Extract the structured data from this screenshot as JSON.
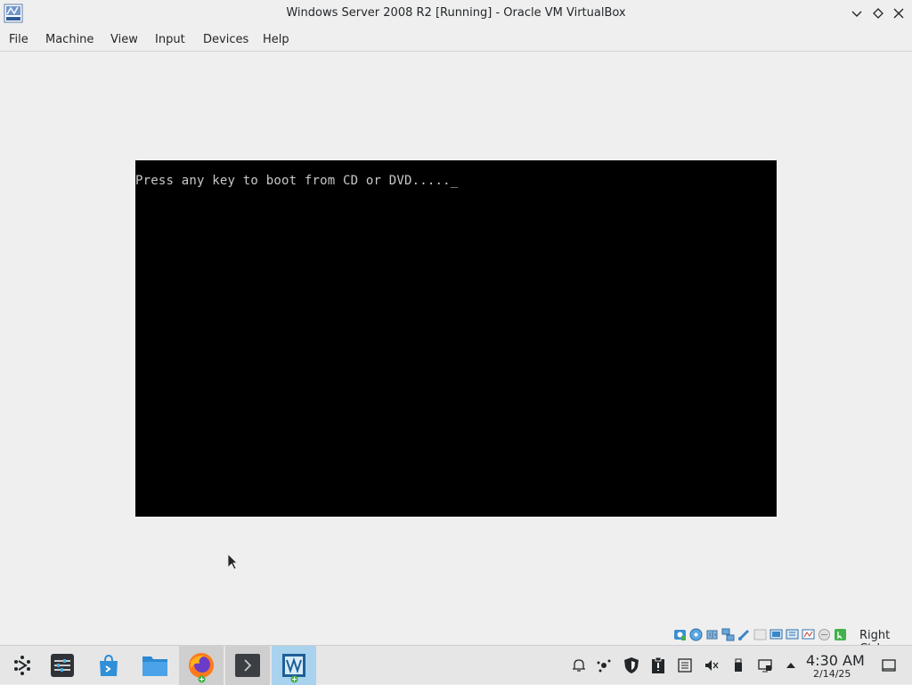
{
  "window": {
    "title": "Windows Server 2008 R2 [Running] - Oracle VM VirtualBox",
    "app_icon": "virtualbox-app-icon",
    "controls": [
      "minimize-icon",
      "maximize-icon",
      "close-icon"
    ]
  },
  "menubar": {
    "items": [
      {
        "label": "File"
      },
      {
        "label": "Machine"
      },
      {
        "label": "View"
      },
      {
        "label": "Input"
      },
      {
        "label": "Devices"
      },
      {
        "label": "Help"
      }
    ]
  },
  "vm": {
    "boot_message": "Press any key to boot from CD or DVD....._"
  },
  "statusbar": {
    "icons": [
      "hard-disk-icon",
      "optical-drive-icon",
      "audio-icon",
      "network-icon",
      "usb-icon",
      "shared-folders-icon",
      "display-icon",
      "recording-icon",
      "video-capture-icon",
      "cpu-icon",
      "mouse-integration-icon",
      "keyboard-icon"
    ],
    "host_key": "Right Ctrl"
  },
  "taskbar": {
    "apps": [
      {
        "name": "application-launcher-icon"
      },
      {
        "name": "system-settings-icon"
      },
      {
        "name": "discover-store-icon"
      },
      {
        "name": "file-manager-icon"
      },
      {
        "name": "firefox-icon"
      },
      {
        "name": "terminal-icon"
      },
      {
        "name": "virtualbox-icon"
      }
    ],
    "tray": [
      "notifications-icon",
      "kde-connect-icon",
      "security-shield-icon",
      "clipboard-icon",
      "updates-icon",
      "volume-muted-icon",
      "removable-device-icon",
      "network-icon",
      "tray-expand-icon"
    ],
    "clock": {
      "time": "4:30 AM",
      "date": "2/14/25"
    }
  },
  "colors": {
    "vm_screen_bg": "#000000",
    "boot_text": "#c8c8c8",
    "active_task_highlight": "#a8d2ee",
    "chrome_bg": "#efefef"
  }
}
